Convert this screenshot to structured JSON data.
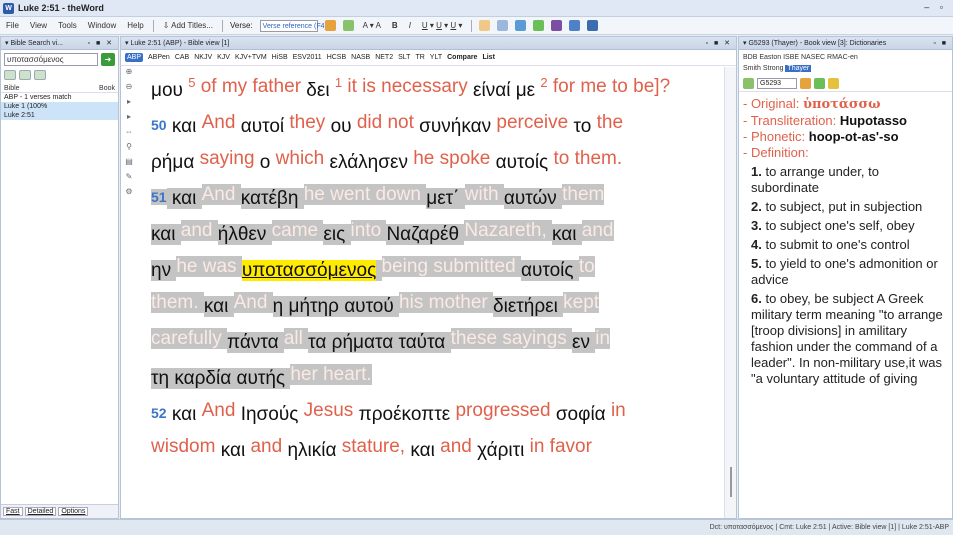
{
  "window": {
    "title": "Luke 2:51 - theWord",
    "controls": "– ▫"
  },
  "menu": [
    "File",
    "View",
    "Tools",
    "Window",
    "Help"
  ],
  "toolbar": {
    "add_titles": "Add Titles...",
    "verse_label": "Verse:",
    "verse_input": "Verse reference (F4)"
  },
  "left": {
    "header": "Bible Search vi...",
    "search_value": "υποτασσόμενος",
    "col_bible": "Bible",
    "col_book": "Book",
    "tree": [
      {
        "text": "ABP - 1 verses match",
        "sel": false
      },
      {
        "text": "Luke                   1 (100%",
        "sel": true
      },
      {
        "text": "    Luke 2:51",
        "sel": true
      }
    ],
    "bottom_tabs": [
      "Fast",
      "Detailed",
      "Options"
    ]
  },
  "mid": {
    "header": "Luke 2:51 (ABP) - Bible view [1]",
    "tabs": [
      "ABP",
      "ABPen",
      "CAB",
      "NKJV",
      "KJV",
      "KJV+TVM",
      "HiSB",
      "ESV2011",
      "HCSB",
      "NASB",
      "NET2",
      "SLT",
      "TR",
      "YLT",
      "Compare",
      "List"
    ],
    "tokens": [
      [
        "g",
        "μου "
      ],
      [
        "n",
        "5"
      ],
      [
        "e",
        " of my father "
      ],
      [
        "g",
        "δει "
      ],
      [
        "n",
        "1"
      ],
      [
        "e",
        " it is necessary "
      ],
      [
        "g",
        "είναί με "
      ],
      [
        "n",
        "2"
      ],
      [
        "e",
        " for me to be]?"
      ],
      [
        "br",
        ""
      ],
      [
        "v",
        "50"
      ],
      [
        "g",
        " και "
      ],
      [
        "e",
        "And "
      ],
      [
        "g",
        "αυτοί "
      ],
      [
        "e",
        "they "
      ],
      [
        "g",
        "ου "
      ],
      [
        "e",
        "did not "
      ],
      [
        "g",
        "συνήκαν "
      ],
      [
        "e",
        "perceive "
      ],
      [
        "g",
        "το "
      ],
      [
        "e",
        "the"
      ],
      [
        "br",
        ""
      ],
      [
        "g",
        "ρήμα "
      ],
      [
        "e",
        "saying "
      ],
      [
        "g",
        "ο "
      ],
      [
        "e",
        "which "
      ],
      [
        "g",
        "ελάλησεν "
      ],
      [
        "e",
        "he spoke "
      ],
      [
        "g",
        "αυτοίς "
      ],
      [
        "e",
        "to them."
      ],
      [
        "br",
        ""
      ],
      [
        "hv",
        "51"
      ],
      [
        "hg",
        " και "
      ],
      [
        "he",
        "And "
      ],
      [
        "hg",
        "κατέβη "
      ],
      [
        "he",
        "he went down "
      ],
      [
        "hg",
        "μετ΄ "
      ],
      [
        "he",
        "with "
      ],
      [
        "hg",
        "αυτών "
      ],
      [
        "he",
        "them"
      ],
      [
        "br",
        ""
      ],
      [
        "hg",
        "και "
      ],
      [
        "he",
        "and "
      ],
      [
        "hg",
        "ήλθεν "
      ],
      [
        "he",
        "came "
      ],
      [
        "hg",
        "εις "
      ],
      [
        "he",
        "into "
      ],
      [
        "hg",
        "Ναζαρέθ "
      ],
      [
        "he",
        "Nazareth, "
      ],
      [
        "hg",
        "και "
      ],
      [
        "he",
        "and"
      ],
      [
        "br",
        ""
      ],
      [
        "hg",
        "ην "
      ],
      [
        "he",
        "he was "
      ],
      [
        "f",
        "υποτασσόμενος"
      ],
      [
        "hg",
        " "
      ],
      [
        "he",
        "being submitted "
      ],
      [
        "hg",
        "αυτοίς "
      ],
      [
        "he",
        "to"
      ],
      [
        "br",
        ""
      ],
      [
        "he",
        "them. "
      ],
      [
        "hg",
        "και "
      ],
      [
        "he",
        "And "
      ],
      [
        "hg",
        "η μήτηρ αυτού "
      ],
      [
        "he",
        "his mother "
      ],
      [
        "hg",
        "διετήρει "
      ],
      [
        "he",
        "kept"
      ],
      [
        "br",
        ""
      ],
      [
        "he",
        "carefully "
      ],
      [
        "hg",
        "πάντα "
      ],
      [
        "he",
        "all "
      ],
      [
        "hg",
        "τα ρήματα ταύτα "
      ],
      [
        "he",
        "these sayings "
      ],
      [
        "hg",
        "εν "
      ],
      [
        "he",
        "in"
      ],
      [
        "br",
        ""
      ],
      [
        "hg",
        "τη καρδία αυτής "
      ],
      [
        "he",
        "her heart."
      ],
      [
        "br",
        ""
      ],
      [
        "v",
        "52"
      ],
      [
        "g",
        " και "
      ],
      [
        "e",
        "And "
      ],
      [
        "g",
        "Ιησούς "
      ],
      [
        "e",
        "Jesus "
      ],
      [
        "g",
        "προέκοπτε "
      ],
      [
        "e",
        "progressed "
      ],
      [
        "g",
        "σοφία "
      ],
      [
        "e",
        "in"
      ],
      [
        "br",
        ""
      ],
      [
        "e",
        "wisdom "
      ],
      [
        "g",
        "και "
      ],
      [
        "e",
        "and "
      ],
      [
        "g",
        "ηλικία "
      ],
      [
        "e",
        "stature, "
      ],
      [
        "g",
        "και "
      ],
      [
        "e",
        "and "
      ],
      [
        "g",
        "χάριτι "
      ],
      [
        "e",
        "in favor"
      ]
    ]
  },
  "right": {
    "header": "G5293 (Thayer) - Book view [3]: Dictionaries",
    "tabs_line1": "BDB  Easton  ISBE  NASEC  RMAC-en",
    "tabs_line2a": "Smith",
    "tabs_line2b": "Strong",
    "active_tab": "Thayer",
    "strong_input": "G5293",
    "original_label": "- Original: ",
    "original_value": "ὑποτάσσω",
    "translit_label": "- Transliteration: ",
    "translit_value": "Hupotasso",
    "phonetic_label": "- Phonetic: ",
    "phonetic_value": "hoop-ot-as'-so",
    "definition_label": "- Definition:",
    "defs": [
      {
        "num": "1.",
        "text": "to arrange under, to subordinate"
      },
      {
        "num": "2.",
        "text": "to subject, put in subjection"
      },
      {
        "num": "3.",
        "text": "to subject one's self, obey"
      },
      {
        "num": "4.",
        "text": "to submit to one's control"
      },
      {
        "num": "5.",
        "text": "to yield to one's admonition or advice"
      },
      {
        "num": "6.",
        "text": "to obey, be subject  A Greek military term meaning \"to arrange [troop divisions] in amilitary fashion under the command of a leader\". In non-military use,it was \"a voluntary attitude of giving"
      }
    ]
  },
  "status": "Dct: υποτασσόμενος  |  Cmt: Luke 2:51  |  Active: Bible view [1]  |  Luke 2:51-ABP"
}
